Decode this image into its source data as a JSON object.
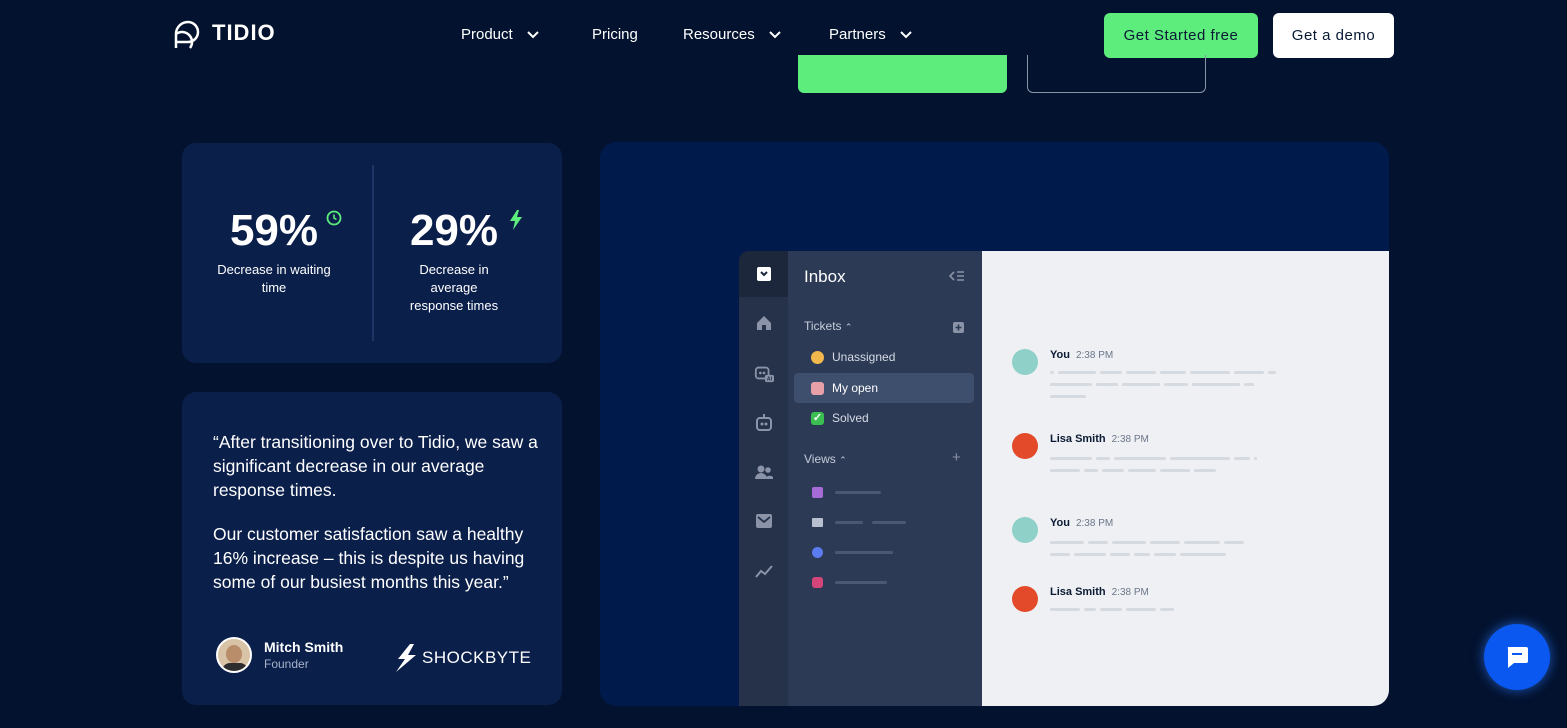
{
  "nav": {
    "brand": "TIDIO",
    "items": [
      {
        "label": "Product",
        "dropdown": true
      },
      {
        "label": "Pricing",
        "dropdown": false
      },
      {
        "label": "Resources",
        "dropdown": true
      },
      {
        "label": "Partners",
        "dropdown": true
      }
    ],
    "cta_primary": "Get Started free",
    "cta_secondary": "Get a demo"
  },
  "stats": [
    {
      "value": "59%",
      "label": "Decrease in waiting time",
      "icon": "clock-icon"
    },
    {
      "value": "29%",
      "label": "Decrease in average response times",
      "icon": "lightning-icon"
    }
  ],
  "testimonial": {
    "paragraphs": [
      "“After transitioning over to Tidio, we saw a significant decrease in our average response times.",
      "Our customer satisfaction saw a healthy 16% increase – this is despite us having some of our busiest months this year.”"
    ],
    "author_name": "Mitch Smith",
    "author_role": "Founder",
    "company": "SHOCKBYTE"
  },
  "app": {
    "title": "Inbox",
    "tickets_label": "Tickets",
    "ticket_items": [
      {
        "label": "Unassigned",
        "icon": "waving-hand-icon",
        "active": false
      },
      {
        "label": "My open",
        "icon": "agent-icon",
        "active": true
      },
      {
        "label": "Solved",
        "icon": "check-icon",
        "active": false
      }
    ],
    "views_label": "Views",
    "messages": [
      {
        "name": "You",
        "time": "2:38 PM"
      },
      {
        "name": "Lisa Smith",
        "time": "2:38 PM"
      },
      {
        "name": "You",
        "time": "2:38 PM"
      },
      {
        "name": "Lisa Smith",
        "time": "2:38 PM"
      }
    ]
  },
  "colors": {
    "background": "#03122e",
    "card": "#0b1f4b",
    "accent_green": "#5ded7d",
    "chat_blue": "#0a58f0"
  }
}
